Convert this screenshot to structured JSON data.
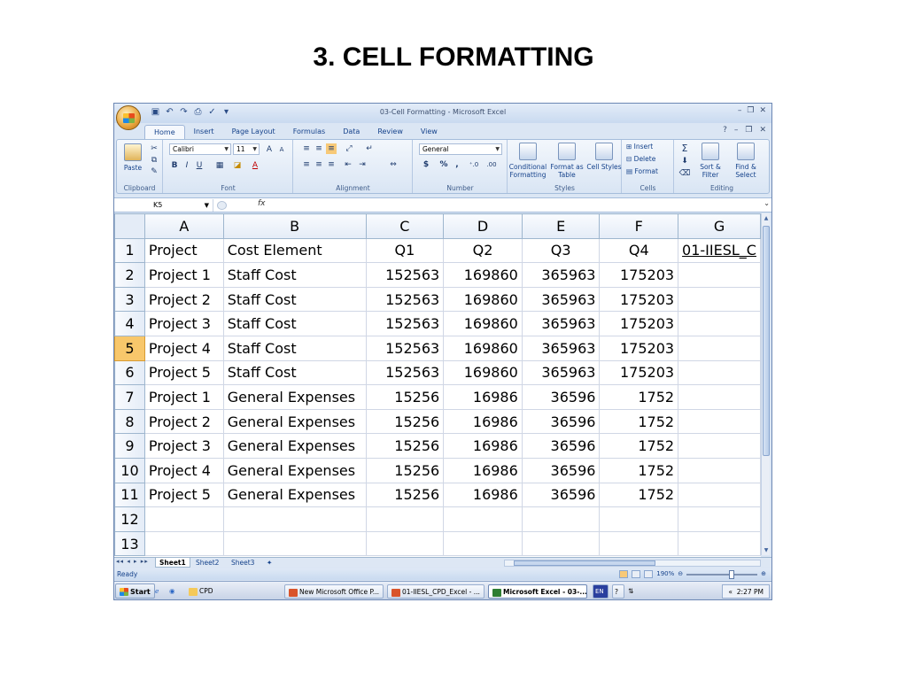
{
  "slide_title": "3. CELL FORMATTING",
  "window": {
    "title": "03-Cell Formatting - Microsoft Excel",
    "tabs": [
      "Home",
      "Insert",
      "Page Layout",
      "Formulas",
      "Data",
      "Review",
      "View"
    ]
  },
  "ribbon": {
    "clipboard": {
      "label": "Clipboard",
      "paste": "Paste"
    },
    "font": {
      "label": "Font",
      "name": "Calibri",
      "size": "11",
      "bold": "B",
      "italic": "I",
      "underline": "U"
    },
    "alignment": {
      "label": "Alignment"
    },
    "number": {
      "label": "Number",
      "format": "General",
      "currency": "$",
      "percent": "%",
      "comma": ","
    },
    "styles": {
      "label": "Styles",
      "conditional": "Conditional Formatting",
      "format_table": "Format as Table",
      "cell_styles": "Cell Styles"
    },
    "cells": {
      "label": "Cells",
      "insert": "Insert",
      "delete": "Delete",
      "format": "Format"
    },
    "editing": {
      "label": "Editing",
      "sum": "Σ",
      "sort": "Sort & Filter",
      "find": "Find & Select"
    }
  },
  "formula_bar": {
    "name_box": "K5",
    "fx": "fx"
  },
  "sheet": {
    "columns": [
      "A",
      "B",
      "C",
      "D",
      "E",
      "F",
      "G"
    ],
    "selected_row": 5,
    "rows": [
      {
        "n": "1",
        "cells": [
          "Project",
          "Cost Element",
          "Q1",
          "Q2",
          "Q3",
          "Q4",
          "01-IIESL_C"
        ]
      },
      {
        "n": "2",
        "cells": [
          "Project 1",
          "Staff Cost",
          "152563",
          "169860",
          "365963",
          "175203",
          ""
        ]
      },
      {
        "n": "3",
        "cells": [
          "Project 2",
          "Staff Cost",
          "152563",
          "169860",
          "365963",
          "175203",
          ""
        ]
      },
      {
        "n": "4",
        "cells": [
          "Project 3",
          "Staff Cost",
          "152563",
          "169860",
          "365963",
          "175203",
          ""
        ]
      },
      {
        "n": "5",
        "cells": [
          "Project 4",
          "Staff Cost",
          "152563",
          "169860",
          "365963",
          "175203",
          ""
        ]
      },
      {
        "n": "6",
        "cells": [
          "Project 5",
          "Staff Cost",
          "152563",
          "169860",
          "365963",
          "175203",
          ""
        ]
      },
      {
        "n": "7",
        "cells": [
          "Project 1",
          "General Expenses",
          "15256",
          "16986",
          "36596",
          "1752",
          ""
        ]
      },
      {
        "n": "8",
        "cells": [
          "Project 2",
          "General Expenses",
          "15256",
          "16986",
          "36596",
          "1752",
          ""
        ]
      },
      {
        "n": "9",
        "cells": [
          "Project 3",
          "General Expenses",
          "15256",
          "16986",
          "36596",
          "1752",
          ""
        ]
      },
      {
        "n": "10",
        "cells": [
          "Project 4",
          "General Expenses",
          "15256",
          "16986",
          "36596",
          "1752",
          ""
        ]
      },
      {
        "n": "11",
        "cells": [
          "Project 5",
          "General Expenses",
          "15256",
          "16986",
          "36596",
          "1752",
          ""
        ]
      },
      {
        "n": "12",
        "cells": [
          "",
          "",
          "",
          "",
          "",
          "",
          ""
        ]
      },
      {
        "n": "13",
        "cells": [
          "",
          "",
          "",
          "",
          "",
          "",
          ""
        ]
      }
    ],
    "tabs": [
      "Sheet1",
      "Sheet2",
      "Sheet3"
    ]
  },
  "status": {
    "text": "Ready",
    "zoom": "190%"
  },
  "taskbar": {
    "start": "Start",
    "items": [
      "CPD",
      "New Microsoft Office P...",
      "01-IIESL_CPD_Excel - ...",
      "Microsoft Excel - 03-..."
    ],
    "lang": "EN",
    "time": "2:27 PM"
  },
  "colors": {
    "selected_row_header": "#f8c76b",
    "link": "#0000ee",
    "ribbon": "#dbe6f4"
  }
}
